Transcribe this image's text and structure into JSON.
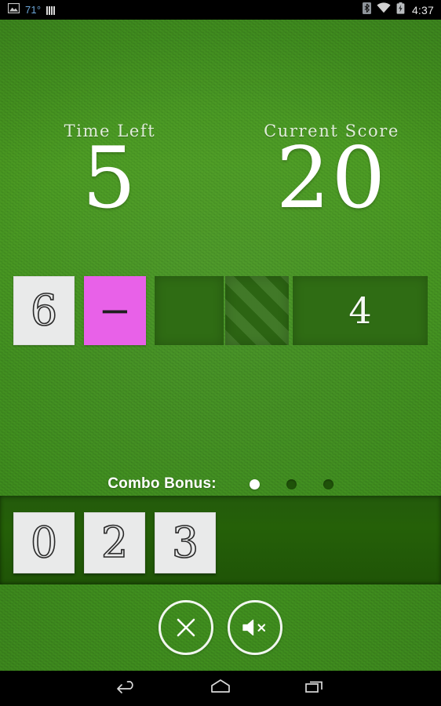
{
  "status_bar": {
    "weather_icon": "photo-image-icon",
    "temperature": "71°",
    "signal_icon": "signal-bars-icon",
    "bluetooth_icon": "bluetooth-icon",
    "wifi_icon": "wifi-icon",
    "battery_icon": "battery-charging-icon",
    "clock": "4:37"
  },
  "header": {
    "time_left_label": "Time Left",
    "time_left_value": "5",
    "current_score_label": "Current Score",
    "current_score_value": "20"
  },
  "equation": {
    "tiles": [
      {
        "kind": "white",
        "value": "6",
        "name": "equation-tile-6"
      },
      {
        "kind": "magenta",
        "value": "−",
        "name": "equation-tile-operator-minus"
      },
      {
        "kind": "slot",
        "value": "",
        "name": "equation-slot-empty"
      },
      {
        "kind": "striped",
        "value": "",
        "name": "equation-slot-striped"
      },
      {
        "kind": "slot",
        "value": "4",
        "name": "equation-slot-target-4"
      }
    ]
  },
  "combo": {
    "label": "Combo Bonus:",
    "dots": [
      "on",
      "off",
      "off"
    ],
    "filled_count": 1,
    "total": 3
  },
  "tray": {
    "tiles": [
      {
        "value": "0",
        "name": "hand-tile-0"
      },
      {
        "value": "2",
        "name": "hand-tile-2"
      },
      {
        "value": "3",
        "name": "hand-tile-3"
      }
    ]
  },
  "actions": {
    "close_icon": "close-x-icon",
    "mute_icon": "speaker-muted-icon"
  },
  "nav_bar": {
    "back_icon": "back-arrow-icon",
    "home_icon": "home-icon",
    "recents_icon": "recent-apps-icon"
  },
  "colors": {
    "field_green": "#3f8d1e",
    "tray_green": "#235a0c",
    "slot_green": "#2f6c14",
    "tile_white": "#e9eaea",
    "operator_magenta": "#e861e8",
    "text_white": "#ffffff",
    "status_temp_blue": "#6ca6d9"
  }
}
